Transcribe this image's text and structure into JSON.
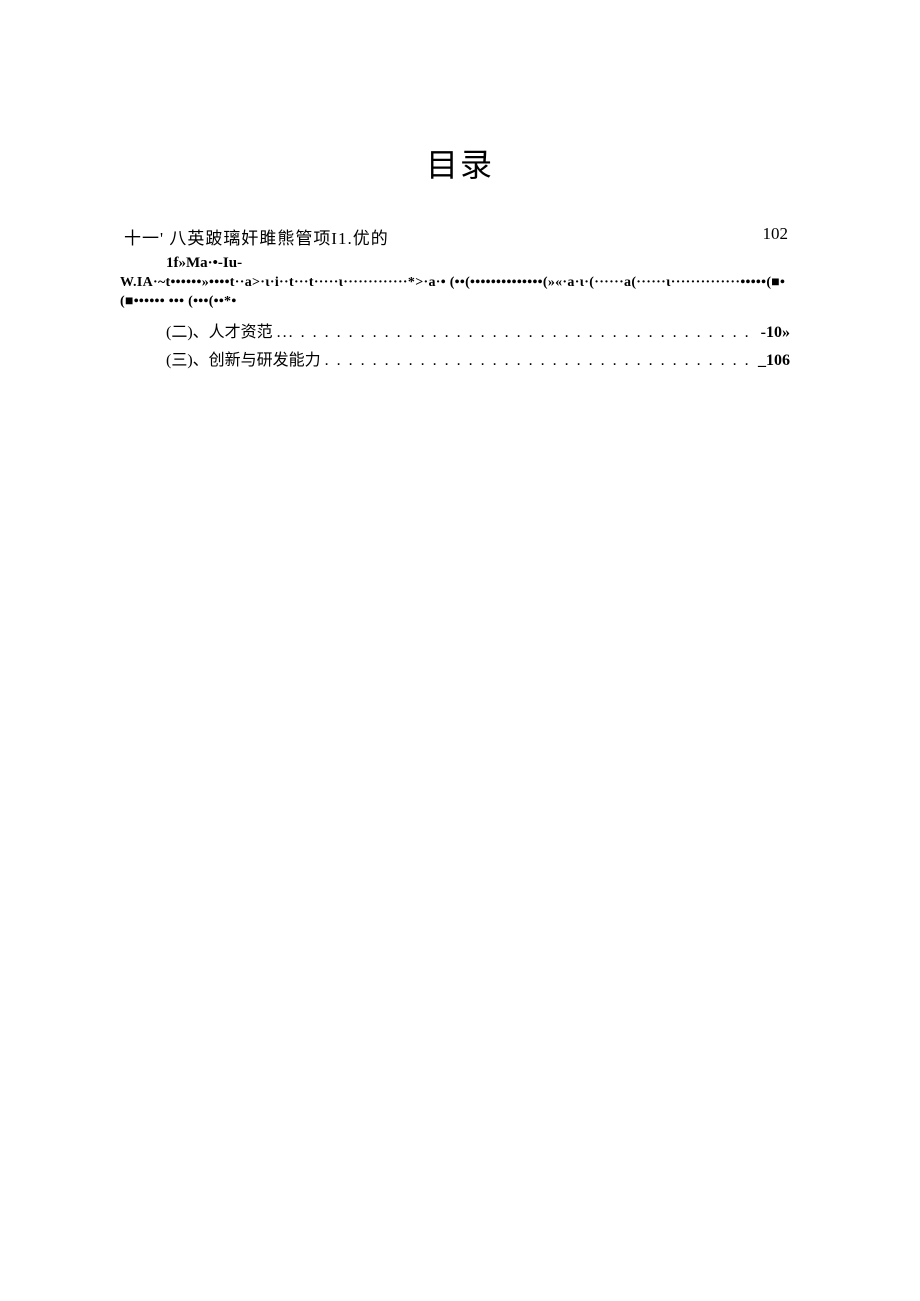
{
  "title": "目录",
  "line1": {
    "left": "十一' 八英跛璃奸雎熊管项I1.优的",
    "right": "102"
  },
  "garbled": {
    "line1": "1f»Ma·•-Iu-",
    "line2": "W.IA·~t••••••»••••t··a>·ι·i··t···t·····ι·············*>·a·• (••(••••••••••••••(»«·a·ι·(······a(······ι··············•••••(■• (■•••••• ••• (•••(••*•"
  },
  "entries": [
    {
      "label": "(二)、人才资范",
      "dots": "... . . . . . . . . . . . . . . . . . . . . . . . . . . . . . . . . . . . . . . . . . . . . . . . . . . . . . . . . . . . . . . . . . . .",
      "page": "-10»"
    },
    {
      "label": "(三)、创新与研发能力",
      "dots": ". . . . . . . . . . . . . . . . . . . . . . . . . . . . . . . . . . . . . . . . . . . . . . . . . . . . . . . . . . .",
      "page": "_106"
    }
  ]
}
